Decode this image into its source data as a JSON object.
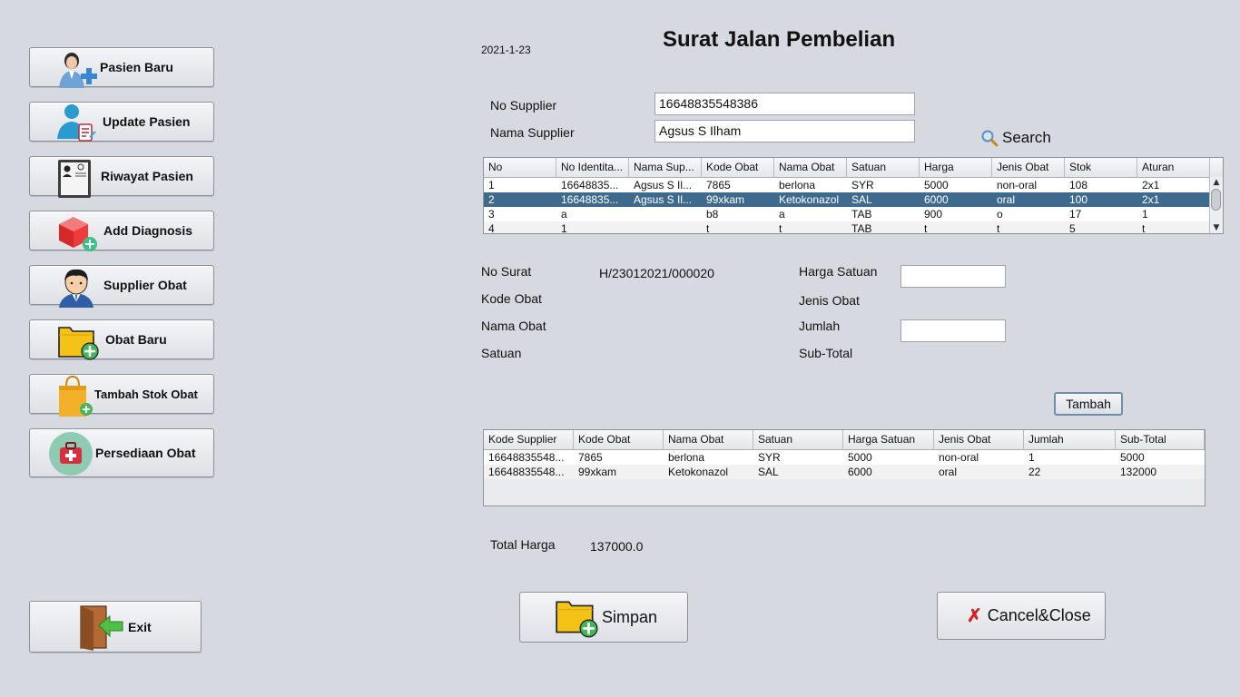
{
  "sidebar": {
    "items": [
      {
        "label": "Pasien Baru",
        "icon": "add-patient-icon"
      },
      {
        "label": "Update Pasien",
        "icon": "update-patient-icon"
      },
      {
        "label": "Riwayat Pasien",
        "icon": "patient-card-icon"
      },
      {
        "label": "Add Diagnosis",
        "icon": "diagnosis-box-icon"
      },
      {
        "label": "Supplier Obat",
        "icon": "supplier-person-icon"
      },
      {
        "label": "Obat Baru",
        "icon": "folder-add-icon"
      },
      {
        "label": "Tambah Stok Obat",
        "icon": "shopping-bag-icon"
      },
      {
        "label": "Persediaan Obat",
        "icon": "medkit-icon"
      }
    ],
    "exit_label": "Exit"
  },
  "header": {
    "date": "2021-1-23",
    "title": "Surat Jalan Pembelian"
  },
  "supplier_form": {
    "no_supplier_label": "No Supplier",
    "no_supplier_value": "16648835548386",
    "nama_supplier_label": "Nama Supplier",
    "nama_supplier_value": "Agsus S Ilham",
    "search_label": "Search"
  },
  "drug_table": {
    "columns": [
      "No",
      "No Identita...",
      "Nama Sup...",
      "Kode Obat",
      "Nama Obat",
      "Satuan",
      "Harga",
      "Jenis Obat",
      "Stok",
      "Aturan"
    ],
    "rows": [
      [
        "1",
        "16648835...",
        "Agsus S Il...",
        "7865",
        "berlona",
        "SYR",
        "5000",
        "non-oral",
        "108",
        "2x1"
      ],
      [
        "2",
        "16648835...",
        "Agsus S Il...",
        "99xkam",
        "Ketokonazol",
        "SAL",
        "6000",
        "oral",
        "100",
        "2x1"
      ],
      [
        "3",
        "a",
        "",
        "b8",
        "a",
        "TAB",
        "900",
        "o",
        "17",
        "1"
      ],
      [
        "4",
        "1",
        "",
        "t",
        "t",
        "TAB",
        "t",
        "t",
        "5",
        "t"
      ]
    ],
    "selected_row": 2
  },
  "detail_form": {
    "no_surat_label": "No Surat",
    "no_surat_value": "H/23012021/000020",
    "kode_obat_label": "Kode Obat",
    "nama_obat_label": "Nama Obat",
    "satuan_label": "Satuan",
    "harga_satuan_label": "Harga Satuan",
    "harga_satuan_value": "",
    "jenis_obat_label": "Jenis Obat",
    "jumlah_label": "Jumlah",
    "jumlah_value": "",
    "subtotal_label": "Sub-Total",
    "tambah_label": "Tambah"
  },
  "order_table": {
    "columns": [
      "Kode Supplier",
      "Kode Obat",
      "Nama Obat",
      "Satuan",
      "Harga Satuan",
      "Jenis Obat",
      "Jumlah",
      "Sub-Total"
    ],
    "rows": [
      [
        "16648835548...",
        "7865",
        "berlona",
        "SYR",
        "5000",
        "non-oral",
        "1",
        "5000"
      ],
      [
        "16648835548...",
        "99xkam",
        "Ketokonazol",
        "SAL",
        "6000",
        "oral",
        "22",
        "132000"
      ]
    ]
  },
  "footer": {
    "total_label": "Total Harga",
    "total_value": "137000.0",
    "simpan_label": "Simpan",
    "cancel_label": "Cancel&Close"
  }
}
